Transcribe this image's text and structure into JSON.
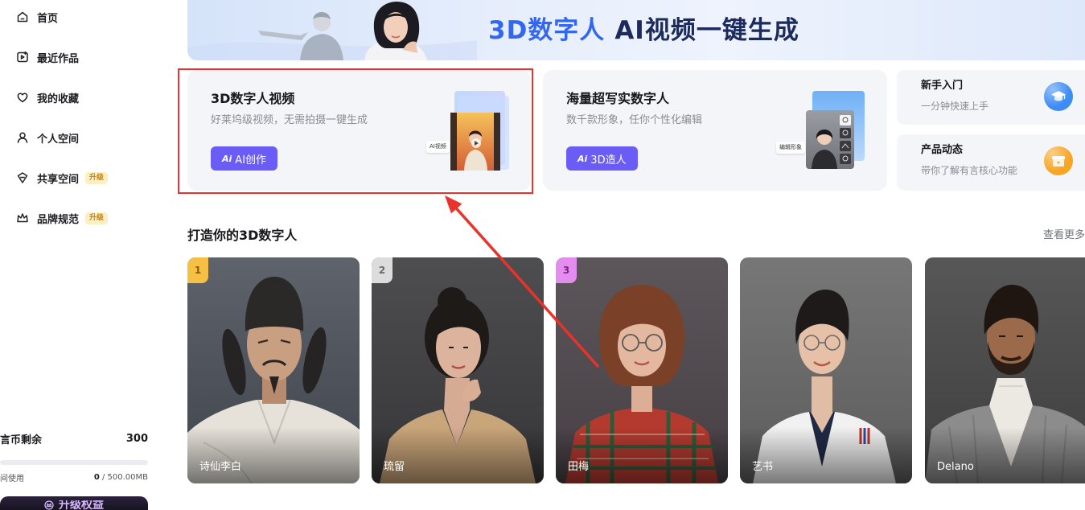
{
  "sidebar": {
    "items": [
      {
        "label": "首页",
        "icon": "home-icon"
      },
      {
        "label": "最近作品",
        "icon": "recent-works-icon"
      },
      {
        "label": "我的收藏",
        "icon": "heart-icon"
      },
      {
        "label": "个人空间",
        "icon": "user-icon"
      },
      {
        "label": "共享空间",
        "icon": "shared-space-icon",
        "badge": "升级"
      },
      {
        "label": "品牌规范",
        "icon": "brand-icon",
        "badge": "升级"
      }
    ],
    "credits": {
      "label": "言币剩余",
      "value": "300"
    },
    "storage": {
      "label": "间使用",
      "used": "0",
      "total": " / 500.00MB",
      "used_fraction": 0
    },
    "upgrade_button": {
      "label": "升级权益",
      "icon": "crown-icon"
    }
  },
  "banner": {
    "highlight": "3D数字人",
    "text": "AI视频一键生成"
  },
  "feature_cards": [
    {
      "title": "3D数字人视频",
      "desc": "好莱坞级视频，无需拍摄一键生成",
      "button_icon": "Ai",
      "button_label": "AI创作",
      "image_tag": "AI视频"
    },
    {
      "title": "海量超写实数字人",
      "desc": "数千款形象，任你个性化编辑",
      "button_icon": "Ai",
      "button_label": "3D造人",
      "image_tag": "编辑形象"
    }
  ],
  "quick_links": [
    {
      "title": "新手入门",
      "desc": "一分钟快速上手",
      "icon": "graduation-cap-icon",
      "color": "#3d8cf5"
    },
    {
      "title": "产品动态",
      "desc": "带你了解有言核心功能",
      "icon": "gift-box-icon",
      "color": "#f7a524"
    }
  ],
  "avatar_section": {
    "title": "打造你的3D数字人",
    "more_label": "查看更多",
    "avatars": [
      {
        "rank": "1",
        "name": "诗仙李白"
      },
      {
        "rank": "2",
        "name": "琉留"
      },
      {
        "rank": "3",
        "name": "田梅"
      },
      {
        "name": "艺书"
      },
      {
        "name": "Delano"
      }
    ]
  },
  "colors": {
    "accent": "#6b5cf6",
    "annotation": "#e8322b",
    "banner_highlight": "#3467ef",
    "banner_text": "#1c2a5e"
  }
}
